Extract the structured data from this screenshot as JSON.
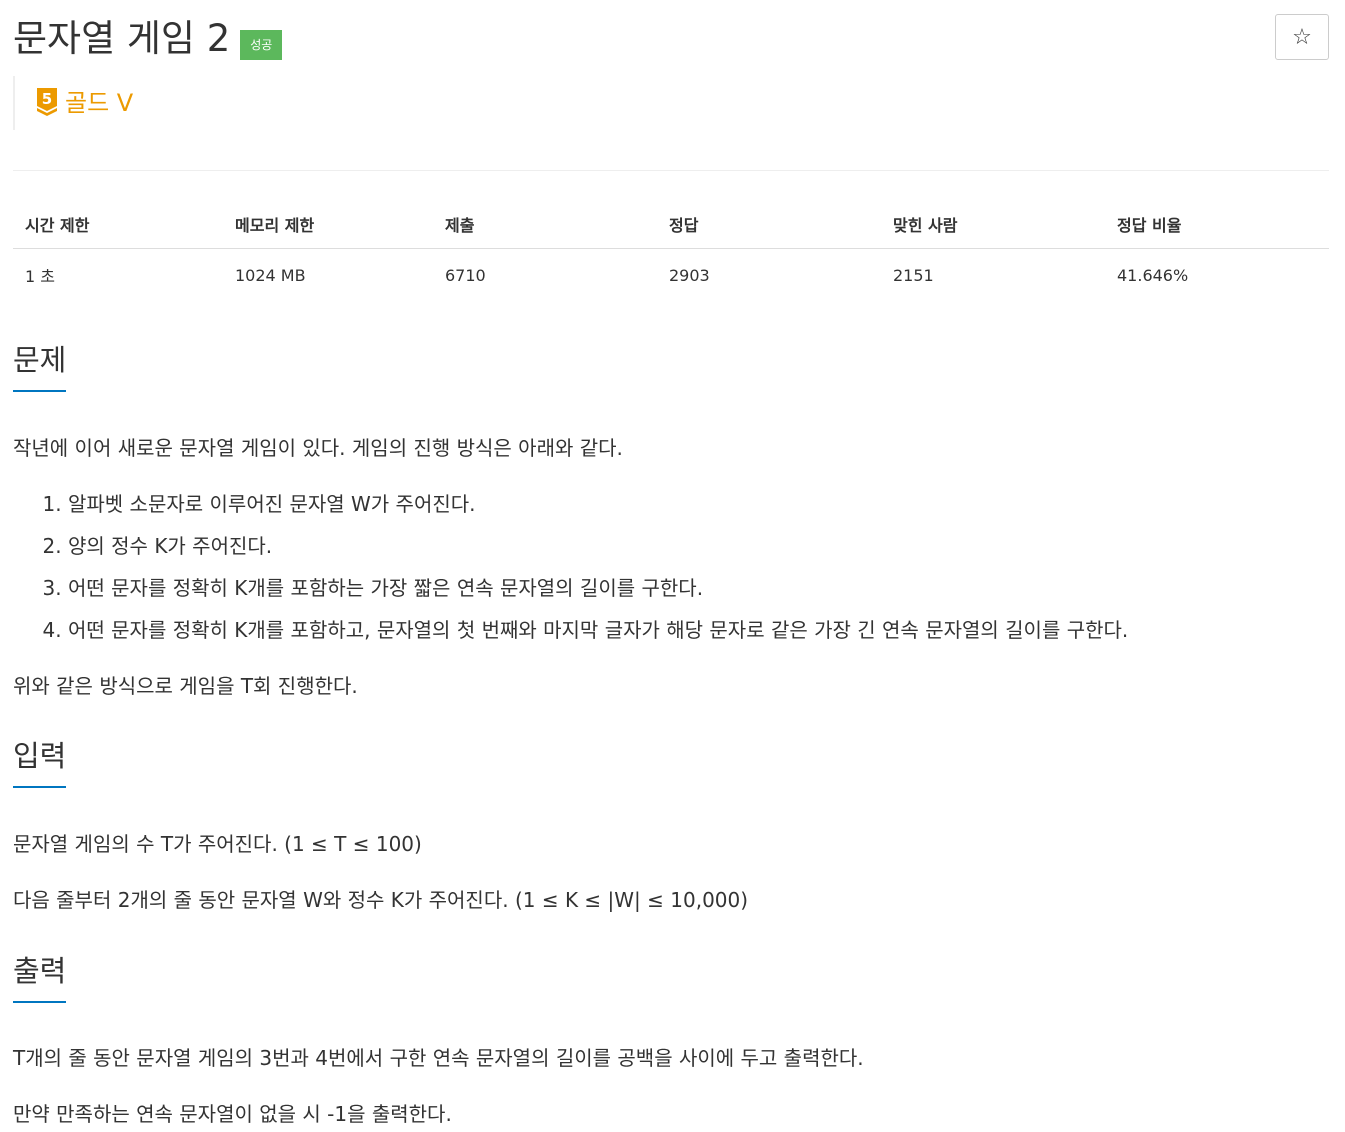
{
  "problem": {
    "title": "문자열 게임 2",
    "status_badge": "성공",
    "favorite_icon": "star-outline-icon",
    "tier": {
      "number": "5",
      "label": "골드 V",
      "color": "#ec9a00"
    }
  },
  "info_table": {
    "headers": [
      "시간 제한",
      "메모리 제한",
      "제출",
      "정답",
      "맞힌 사람",
      "정답 비율"
    ],
    "values": [
      "1 초",
      "1024 MB",
      "6710",
      "2903",
      "2151",
      "41.646%"
    ]
  },
  "sections": {
    "description": {
      "heading": "문제",
      "intro": "작년에 이어 새로운 문자열 게임이 있다. 게임의 진행 방식은 아래와 같다.",
      "steps": [
        "알파벳 소문자로 이루어진 문자열 W가 주어진다.",
        "양의 정수 K가 주어진다.",
        "어떤 문자를 정확히 K개를 포함하는 가장 짧은 연속 문자열의 길이를 구한다.",
        "어떤 문자를 정확히 K개를 포함하고, 문자열의 첫 번째와 마지막 글자가 해당 문자로 같은 가장 긴 연속 문자열의 길이를 구한다."
      ],
      "outro": "위와 같은 방식으로 게임을 T회 진행한다."
    },
    "input": {
      "heading": "입력",
      "lines": [
        "문자열 게임의 수 T가 주어진다. (1 ≤ T ≤ 100)",
        "다음 줄부터 2개의 줄 동안 문자열 W와 정수 K가 주어진다. (1 ≤ K ≤ |W| ≤ 10,000)"
      ]
    },
    "output": {
      "heading": "출력",
      "lines": [
        "T개의 줄 동안 문자열 게임의 3번과 4번에서 구한 연속 문자열의 길이를 공백을 사이에 두고 출력한다.",
        "만약 만족하는 연속 문자열이 없을 시 -1을 출력한다."
      ]
    }
  },
  "colors": {
    "success": "#5cb85c",
    "accent_underline": "#0076c0",
    "tier_gold": "#ec9a00"
  }
}
